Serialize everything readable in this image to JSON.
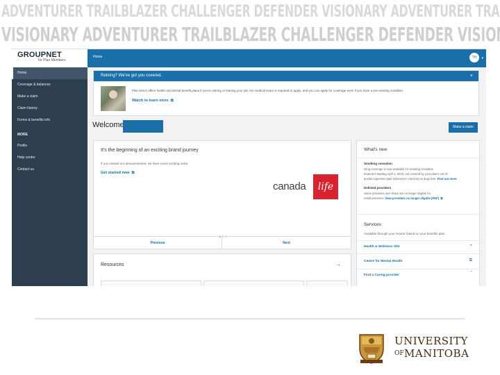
{
  "banner": {
    "row1": "ADVENTURER TRAILBLAZER CHALLENGER DEFENDER VISIONARY ADVENTURER TRAILBLAZER CHALLENGER",
    "row2": "VISIONARY ADVENTURER TRAILBLAZER CHALLENGER DEFENDER VISIONARY"
  },
  "app": {
    "brand_name": "GROUPNET",
    "brand_sub": "for Plan Members",
    "home_label": "Home",
    "avatar_initials": "TH"
  },
  "sidebar": {
    "items": [
      {
        "label": "Home"
      },
      {
        "label": "Coverage & balances"
      },
      {
        "label": "Make a claim"
      },
      {
        "label": "Claim history"
      },
      {
        "label": "Forms & benefits info"
      }
    ],
    "section_label": "MORE",
    "more_items": [
      {
        "label": "Profile"
      },
      {
        "label": "Help centre"
      },
      {
        "label": "Contact us"
      }
    ]
  },
  "alert": {
    "title": "Retiring? We've got you covered.",
    "close": "×",
    "body": "Plan Direct offers health and dental benefit plans if you're retiring or leaving your job. No medical exam is required to apply, and you can apply for coverage even if you have a pre-existing condition.",
    "link": "Watch to learn more"
  },
  "welcome": {
    "label": "Welcome",
    "claim_button": "Make a claim"
  },
  "journey": {
    "title": "It's the beginning of an exciting brand journey",
    "text": "If you missed our announcement, we have some exciting news.",
    "link": "Get started now",
    "logo_word": "canada",
    "logo_box": "life",
    "prev": "Previous",
    "next": "Next"
  },
  "resources": {
    "title": "Resources",
    "arrow": "→"
  },
  "whats_new": {
    "title": "What's new",
    "item1_title": "Smoking cessation",
    "item1_lines": [
      "Drug coverage is now available for smoking cessation",
      "treatment starting April 1, 2019, not covered by your plan's out-of-",
      "pocket expenses paid (whenever cost less) at drug time."
    ],
    "item1_link": "Find out more",
    "item2_title": "Delisted providers",
    "item2_lines": [
      "Some providers and clinics are no longer eligible for",
      "reimbursement."
    ],
    "item2_link": "View providers no longer eligible (PDF)"
  },
  "services": {
    "title": "Services",
    "subtitle": "Available through your insurer based on your benefits plan.",
    "items": [
      {
        "label": "Health & Wellness Site",
        "icon": "plus-icon"
      },
      {
        "label": "Centre for Mental Health",
        "icon": "external-link-icon"
      },
      {
        "label": "Find a Caring provider",
        "icon": "chevron-up-icon"
      }
    ]
  },
  "university": {
    "line1": "UNIVERSITY",
    "line2_of": "OF",
    "line2": "MANITOBA"
  },
  "colors": {
    "primary_blue": "#1a6fa8",
    "sidebar": "#2d3e4e",
    "canada_life_red": "#d8222f",
    "um_brown": "#4a2a12",
    "um_gold": "#c9973a"
  }
}
